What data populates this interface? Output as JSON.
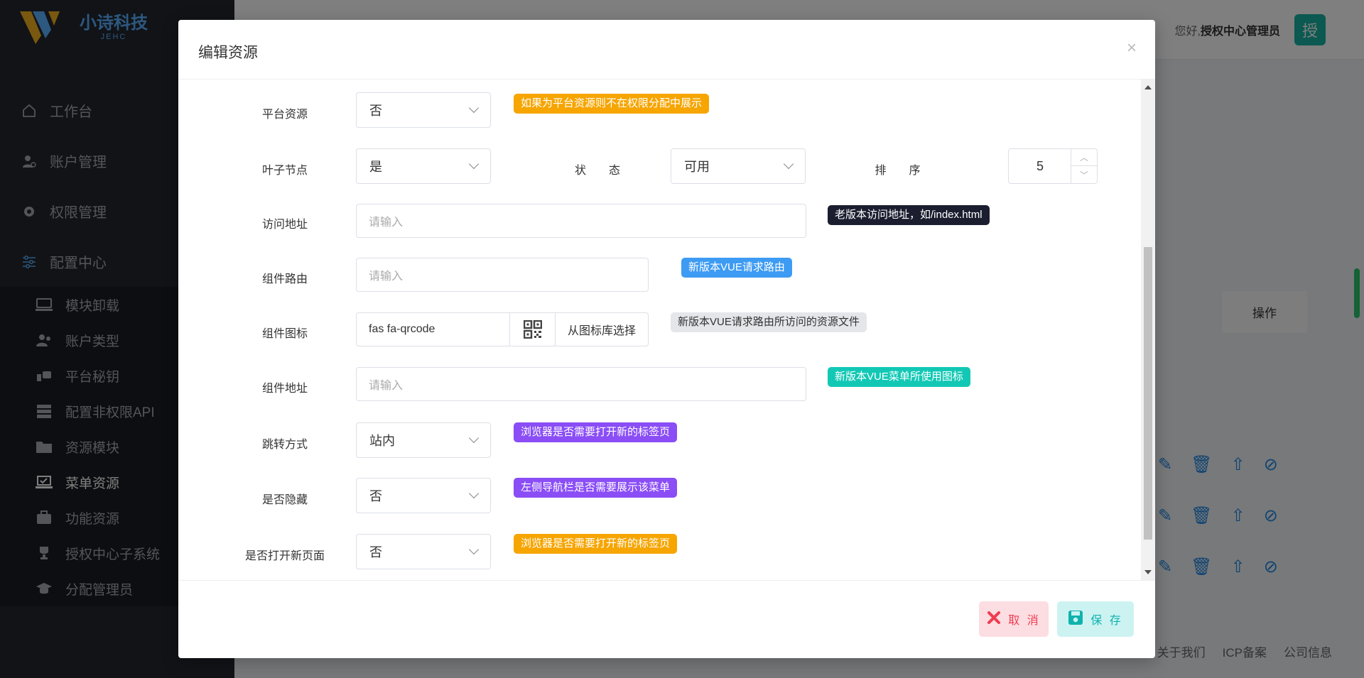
{
  "app": {
    "brand_name": "小诗科技",
    "brand_sub": "JEHC",
    "greeting_prefix": "您好,",
    "user_name": "授权中心管理员",
    "avatar_char": "授",
    "table_ops_header": "操作",
    "footer_links": [
      "关于我们",
      "ICP备案",
      "公司信息"
    ]
  },
  "sidebar": {
    "items": [
      {
        "label": "工作台",
        "icon": "home-icon"
      },
      {
        "label": "账户管理",
        "icon": "user-gear-icon"
      },
      {
        "label": "权限管理",
        "icon": "gear-icon"
      },
      {
        "label": "配置中心",
        "icon": "sliders-icon"
      }
    ],
    "subitems": [
      {
        "label": "模块卸载",
        "icon": "monitor-icon"
      },
      {
        "label": "账户类型",
        "icon": "users-icon"
      },
      {
        "label": "平台秘钥",
        "icon": "key-icon"
      },
      {
        "label": "配置非权限API",
        "icon": "server-icon"
      },
      {
        "label": "资源模块",
        "icon": "folder-icon"
      },
      {
        "label": "菜单资源",
        "icon": "laptop-check-icon",
        "active": true
      },
      {
        "label": "功能资源",
        "icon": "briefcase-icon"
      },
      {
        "label": "授权中心子系统",
        "icon": "trophy-icon"
      },
      {
        "label": "分配管理员",
        "icon": "graduation-icon"
      }
    ]
  },
  "modal": {
    "title": "编辑资源",
    "close_symbol": "×",
    "fields": {
      "platform_resource": {
        "label": "平台资源",
        "value": "否",
        "hint": "如果为平台资源则不在权限分配中展示"
      },
      "leaf_node": {
        "label": "叶子节点",
        "value": "是"
      },
      "status": {
        "label": "状　　态",
        "value": "可用"
      },
      "sort": {
        "label": "排　　序",
        "value": "5"
      },
      "access_url": {
        "label": "访问地址",
        "placeholder": "请输入",
        "hint": "老版本访问地址，如/index.html"
      },
      "component_route": {
        "label": "组件路由",
        "placeholder": "请输入",
        "hint": "新版本VUE请求路由"
      },
      "component_icon": {
        "label": "组件图标",
        "value": "fas fa-qrcode",
        "button": "从图标库选择",
        "hint": "新版本VUE请求路由所访问的资源文件"
      },
      "component_url": {
        "label": "组件地址",
        "placeholder": "请输入",
        "hint": "新版本VUE菜单所使用图标"
      },
      "jump_mode": {
        "label": "跳转方式",
        "value": "站内",
        "hint": "浏览器是否需要打开新的标签页"
      },
      "hidden": {
        "label": "是否隐藏",
        "value": "否",
        "hint": "左侧导航栏是否需要展示该菜单"
      },
      "open_new_page": {
        "label": "是否打开新页面",
        "value": "否",
        "hint": "浏览器是否需要打开新的标签页"
      }
    },
    "footer": {
      "cancel_label": "取 消",
      "save_label": "保 存"
    }
  },
  "colors": {
    "tag_orange": "#f6a501",
    "tag_dark": "#1a1e2f",
    "tag_blue": "#3d9bf3",
    "tag_gray": "#e4e6ea",
    "tag_teal": "#12c8b5",
    "tag_purple": "#8a4df6",
    "cancel": "#f03b50",
    "save": "#0fb3ad"
  }
}
